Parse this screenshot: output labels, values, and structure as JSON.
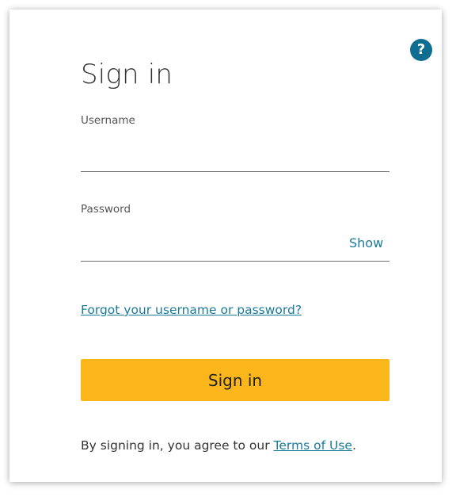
{
  "help": {
    "icon": "question-mark-icon",
    "glyph": "?",
    "color": "#0f6e8f"
  },
  "title": "Sign in",
  "username": {
    "label": "Username",
    "value": "",
    "placeholder": ""
  },
  "password": {
    "label": "Password",
    "value": "",
    "placeholder": "",
    "toggle_label": "Show"
  },
  "forgot_link": "Forgot your username or password?",
  "signin_button": {
    "label": "Sign in",
    "color": "#fbb61b"
  },
  "terms": {
    "prefix": "By signing in, you agree to our ",
    "link": "Terms of Use",
    "suffix": "."
  },
  "accent_color": "#1a7a9a"
}
